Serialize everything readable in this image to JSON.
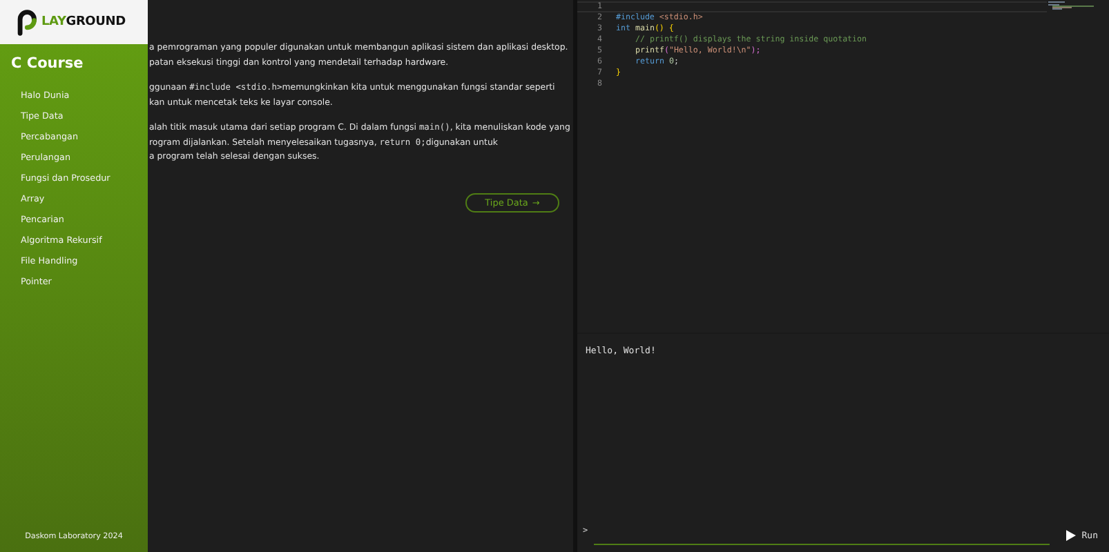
{
  "sidebar": {
    "logo_text": [
      {
        "text": "LAY",
        "color": "#5e9a12"
      },
      {
        "text": "GROUND",
        "color": "#111111"
      }
    ],
    "title": "C Course",
    "items": [
      {
        "label": "Halo Dunia"
      },
      {
        "label": "Tipe Data"
      },
      {
        "label": "Percabangan"
      },
      {
        "label": "Perulangan"
      },
      {
        "label": "Fungsi dan Prosedur"
      },
      {
        "label": "Array"
      },
      {
        "label": "Pencarian"
      },
      {
        "label": "Algoritma Rekursif"
      },
      {
        "label": "File Handling"
      },
      {
        "label": "Pointer"
      }
    ],
    "footer": "Daskom Laboratory 2024"
  },
  "lesson": {
    "paragraphs": [
      [
        [
          {
            "kind": "text",
            "text": "a pemrograman yang populer digunakan untuk membangun aplikasi sistem dan aplikasi desktop."
          }
        ],
        [
          {
            "kind": "text",
            "text": "patan eksekusi tinggi dan kontrol yang mendetail terhadap hardware."
          }
        ]
      ],
      [
        [
          {
            "kind": "text",
            "text": "ggunaan "
          },
          {
            "kind": "code",
            "text": "#include <stdio.h>"
          },
          {
            "kind": "text",
            "text": "memungkinkan kita untuk menggunakan fungsi standar seperti"
          }
        ],
        [
          {
            "kind": "text",
            "text": "kan untuk mencetak teks ke layar console."
          }
        ]
      ],
      [
        [
          {
            "kind": "text",
            "text": "alah titik masuk utama dari setiap program C. Di dalam fungsi "
          },
          {
            "kind": "code",
            "text": "main()"
          },
          {
            "kind": "text",
            "text": ", kita menuliskan kode yang"
          }
        ],
        [
          {
            "kind": "text",
            "text": "rogram dijalankan. Setelah menyelesaikan tugasnya, "
          },
          {
            "kind": "code",
            "text": "return 0;"
          },
          {
            "kind": "text",
            "text": "digunakan untuk"
          }
        ],
        [
          {
            "kind": "text",
            "text": "a program telah selesai dengan sukses."
          }
        ]
      ]
    ],
    "next_button": {
      "label": "Tipe Data",
      "arrow": "→"
    }
  },
  "editor": {
    "lines": [
      {
        "number": "1"
      },
      {
        "number": "2",
        "tokens": [
          {
            "kind": "keyword",
            "text": "#include "
          },
          {
            "kind": "string",
            "text": "<stdio.h>"
          }
        ]
      },
      {
        "number": "3",
        "tokens": [
          {
            "kind": "keyword",
            "text": "int "
          },
          {
            "kind": "function",
            "text": "main"
          },
          {
            "kind": "bracket",
            "text": "() {"
          }
        ]
      },
      {
        "number": "4",
        "indent": true,
        "tokens": [
          {
            "kind": "comment",
            "text": "// printf() displays the string inside quotation"
          }
        ]
      },
      {
        "number": "5",
        "indent": true,
        "tokens": [
          {
            "kind": "function",
            "text": "printf"
          },
          {
            "kind": "punct",
            "text": "("
          },
          {
            "kind": "string",
            "text": "\"Hello, World!\\n\""
          },
          {
            "kind": "punct",
            "text": ");"
          }
        ]
      },
      {
        "number": "6",
        "indent": true,
        "tokens": [
          {
            "kind": "keyword",
            "text": "return "
          },
          {
            "kind": "number",
            "text": "0"
          },
          {
            "kind": "plain",
            "text": ";"
          }
        ]
      },
      {
        "number": "7",
        "tokens": [
          {
            "kind": "bracket",
            "text": "}"
          }
        ]
      },
      {
        "number": "8"
      }
    ]
  },
  "output": {
    "text": "Hello, World!"
  },
  "console": {
    "prompt": ">",
    "run_label": "Run"
  }
}
